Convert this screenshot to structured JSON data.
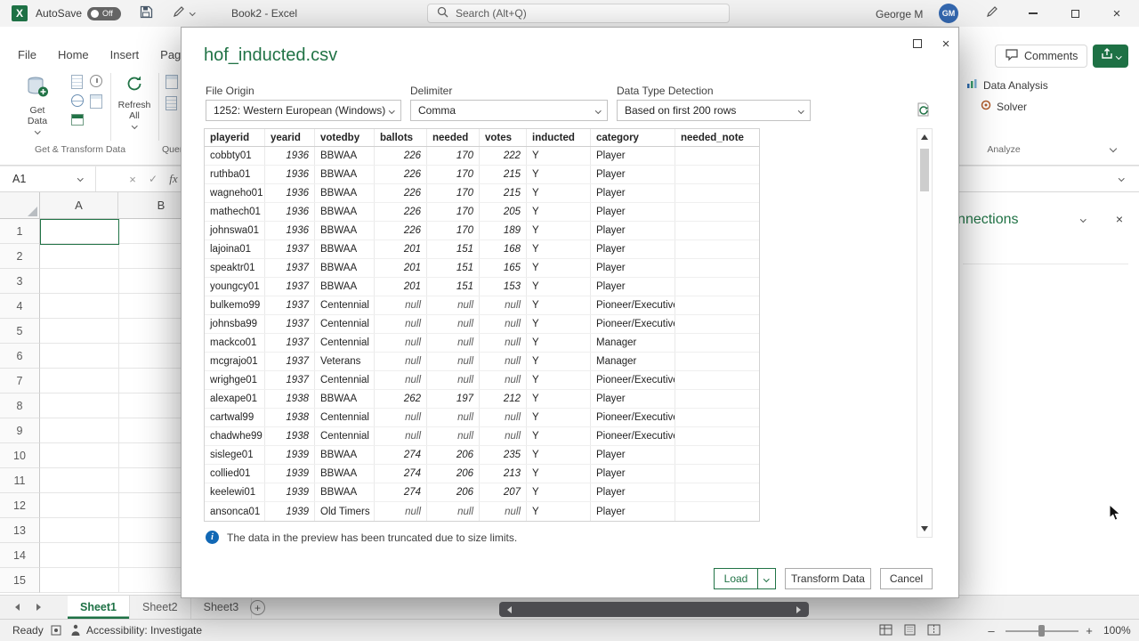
{
  "icons": {
    "close": "×",
    "new_sheet": "+",
    "zoom_out": "–",
    "zoom_in": "+",
    "info": "i",
    "excel_logo_letter": "X"
  },
  "titlebar": {
    "autosave_label": "AutoSave",
    "autosave_state": "Off",
    "workbook_title": "Book2 - Excel",
    "search_placeholder": "Search (Alt+Q)",
    "user_name": "George M",
    "user_initials": "GM"
  },
  "ribbon": {
    "tabs": [
      "File",
      "Home",
      "Insert",
      "Page Layout"
    ],
    "get_data_label": "Get Data",
    "refresh_all_label": "Refresh All",
    "group_get_transform_label": "Get & Transform Data",
    "group_queries_label": "Queries & Connections",
    "comments_label": "Comments",
    "data_analysis_label": "Data Analysis",
    "solver_label": "Solver",
    "analyze_group_label": "Analyze"
  },
  "formula_bar": {
    "name_box_value": "A1",
    "fx_label": "fx"
  },
  "grid": {
    "columns": [
      "A",
      "B"
    ],
    "rows": [
      "1",
      "2",
      "3",
      "4",
      "5",
      "6",
      "7",
      "8",
      "9",
      "10",
      "11",
      "12",
      "13",
      "14",
      "15"
    ]
  },
  "queries_panel": {
    "title": "Queries & Connections"
  },
  "sheet_tabs": [
    {
      "label": "Sheet1",
      "active": true
    },
    {
      "label": "Sheet2",
      "active": false
    },
    {
      "label": "Sheet3",
      "active": false
    }
  ],
  "status_bar": {
    "ready_label": "Ready",
    "accessibility_label": "Accessibility: Investigate",
    "zoom_level": "100%"
  },
  "dialog": {
    "title": "hof_inducted.csv",
    "file_origin": {
      "label": "File Origin",
      "value": "1252: Western European (Windows)"
    },
    "delimiter": {
      "label": "Delimiter",
      "value": "Comma"
    },
    "data_type_detection": {
      "label": "Data Type Detection",
      "value": "Based on first 200 rows"
    },
    "truncation_notice": "The data in the preview has been truncated due to size limits.",
    "buttons": {
      "load": "Load",
      "transform": "Transform Data",
      "cancel": "Cancel"
    },
    "table": {
      "headers": [
        "playerid",
        "yearid",
        "votedby",
        "ballots",
        "needed",
        "votes",
        "inducted",
        "category",
        "needed_note"
      ],
      "rows": [
        [
          "cobbty01",
          "1936",
          "BBWAA",
          "226",
          "170",
          "222",
          "Y",
          "Player",
          ""
        ],
        [
          "ruthba01",
          "1936",
          "BBWAA",
          "226",
          "170",
          "215",
          "Y",
          "Player",
          ""
        ],
        [
          "wagneho01",
          "1936",
          "BBWAA",
          "226",
          "170",
          "215",
          "Y",
          "Player",
          ""
        ],
        [
          "mathech01",
          "1936",
          "BBWAA",
          "226",
          "170",
          "205",
          "Y",
          "Player",
          ""
        ],
        [
          "johnswa01",
          "1936",
          "BBWAA",
          "226",
          "170",
          "189",
          "Y",
          "Player",
          ""
        ],
        [
          "lajoina01",
          "1937",
          "BBWAA",
          "201",
          "151",
          "168",
          "Y",
          "Player",
          ""
        ],
        [
          "speaktr01",
          "1937",
          "BBWAA",
          "201",
          "151",
          "165",
          "Y",
          "Player",
          ""
        ],
        [
          "youngcy01",
          "1937",
          "BBWAA",
          "201",
          "151",
          "153",
          "Y",
          "Player",
          ""
        ],
        [
          "bulkemo99",
          "1937",
          "Centennial",
          "null",
          "null",
          "null",
          "Y",
          "Pioneer/Executive",
          ""
        ],
        [
          "johnsba99",
          "1937",
          "Centennial",
          "null",
          "null",
          "null",
          "Y",
          "Pioneer/Executive",
          ""
        ],
        [
          "mackco01",
          "1937",
          "Centennial",
          "null",
          "null",
          "null",
          "Y",
          "Manager",
          ""
        ],
        [
          "mcgrajo01",
          "1937",
          "Veterans",
          "null",
          "null",
          "null",
          "Y",
          "Manager",
          ""
        ],
        [
          "wrighge01",
          "1937",
          "Centennial",
          "null",
          "null",
          "null",
          "Y",
          "Pioneer/Executive",
          ""
        ],
        [
          "alexape01",
          "1938",
          "BBWAA",
          "262",
          "197",
          "212",
          "Y",
          "Player",
          ""
        ],
        [
          "cartwal99",
          "1938",
          "Centennial",
          "null",
          "null",
          "null",
          "Y",
          "Pioneer/Executive",
          ""
        ],
        [
          "chadwhe99",
          "1938",
          "Centennial",
          "null",
          "null",
          "null",
          "Y",
          "Pioneer/Executive",
          ""
        ],
        [
          "sislege01",
          "1939",
          "BBWAA",
          "274",
          "206",
          "235",
          "Y",
          "Player",
          ""
        ],
        [
          "collied01",
          "1939",
          "BBWAA",
          "274",
          "206",
          "213",
          "Y",
          "Player",
          ""
        ],
        [
          "keelewi01",
          "1939",
          "BBWAA",
          "274",
          "206",
          "207",
          "Y",
          "Player",
          ""
        ],
        [
          "ansonca01",
          "1939",
          "Old Timers",
          "null",
          "null",
          "null",
          "Y",
          "Player",
          ""
        ]
      ]
    }
  }
}
